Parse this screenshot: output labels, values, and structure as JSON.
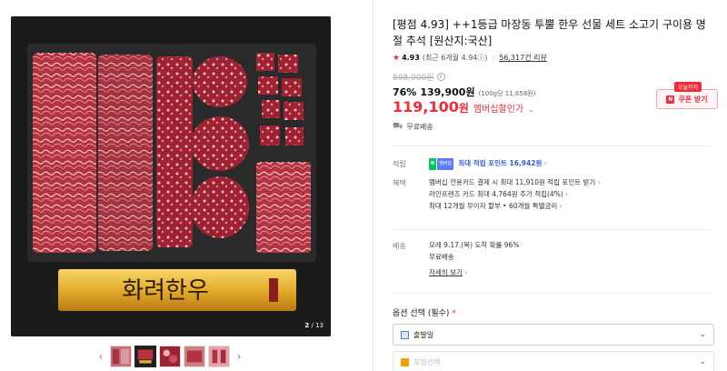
{
  "gallery": {
    "image_text": "화려한우",
    "counter_current": "2",
    "counter_total": "/ 13",
    "thumb_prev": "‹",
    "thumb_next": "›",
    "thumbs": [
      "thumb1",
      "thumb2",
      "thumb3",
      "thumb4",
      "thumb5"
    ]
  },
  "product": {
    "title": "[평점 4.93] ++1등급 마장동 투뿔 한우 선물 세트 소고기 구이용 명절 추석 [원산지:국산]",
    "rating": "4.93",
    "rating_recent": "(최근 6개월 4.94ⓘ)",
    "reviews": "56,317건 리뷰",
    "original_price": "598,000원",
    "discount": "76%",
    "sale_price": "139,900원",
    "unit_price": "(100g당 11,658원)",
    "member_price": "119,100",
    "member_price_unit": "원",
    "member_label": "멤버십할인가",
    "coupon_badge": "오늘까지",
    "coupon_label": "쿠폰 받기",
    "coupon_icon": "N",
    "shipping": "무료배송"
  },
  "points": {
    "label": "적립",
    "npay_n": "N",
    "npay_m": "멤버쉽",
    "text": "최대 적립 포인트 16,942원"
  },
  "benefits": {
    "label": "혜택",
    "items": [
      "멤버십 전용카드 결제 시 최대 11,910원 적립 포인트 받기",
      "라인프렌즈 카드 최대 4,764원 추가 적립(4%)",
      "최대 12개월 무이자 할부 • 60개월 특별금리"
    ]
  },
  "delivery": {
    "label": "배송",
    "arrival": "모레 9.17.(목) 도착 확률 96%",
    "fee": "무료배송",
    "detail": "자세히 보기"
  },
  "options": {
    "title": "옵션 선택 (필수)",
    "required_mark": "*",
    "select1": "출발일",
    "select2": "포장선택"
  },
  "icons": {
    "chevron_right": "›",
    "chevron_down": "⌄",
    "truck": "⛟",
    "star": "★"
  },
  "colors": {
    "accent": "#f42b3a",
    "point": "#3b5bdb",
    "npay": "#03c75a"
  }
}
